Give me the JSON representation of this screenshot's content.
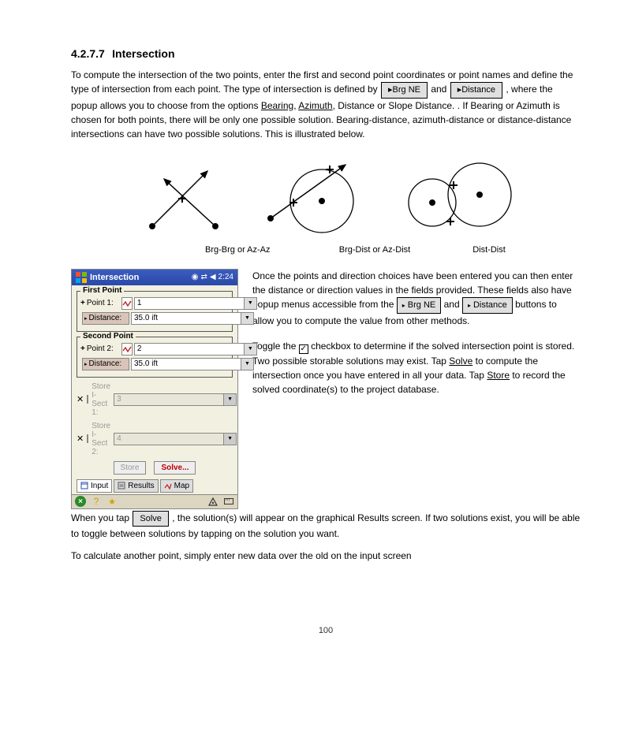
{
  "heading": {
    "num": "4.2.7.7",
    "title": "Intersection"
  },
  "para1": "To compute the intersection of the two points, enter the first and second point coordinates or point names and define the type of intersection from each point. The type of intersection is defined by ",
  "para1_mid": " and ",
  "para1_end": ", where the popup allows you to choose from the options ",
  "bearing": "Bearing",
  "azimuth": "Azimuth",
  "dist": "Distance",
  "para1_tail": " or ",
  "slope_dist": "Slope Distance",
  "para1_final": ". If Bearing or Azimuth is chosen for both points, there will be only one possible solution. Bearing-distance, azimuth-distance or distance-distance intersections can have two possible solutions. This is illustrated below.",
  "labels": {
    "l1": "Brg-Brg or Az-Az",
    "l2": "Brg-Dist or Az-Dist",
    "l3": "Dist-Dist"
  },
  "device": {
    "title": "Intersection",
    "time": "2:24",
    "fp": {
      "legend": "First Point",
      "point_lbl": "Point 1:",
      "point_val": "1",
      "dist_lbl": "Distance:",
      "dist_val": "35.0 ift"
    },
    "sp": {
      "legend": "Second Point",
      "point_lbl": "Point 2:",
      "point_val": "2",
      "dist_lbl": "Distance:",
      "dist_val": "35.0 ift"
    },
    "store1": {
      "lbl": "Store I-Sect 1:",
      "val": "3"
    },
    "store2": {
      "lbl": "Store I-Sect 2:",
      "val": "4"
    },
    "btn_store": "Store",
    "btn_solve": "Solve...",
    "tab_input": "Input",
    "tab_results": "Results",
    "tab_map": "Map"
  },
  "right": {
    "p1a": "Once the points and direction choices have been entered you can then enter the distance or direction values in the fields provided. These fields also have popup menus accessible from the ",
    "p1b": " and ",
    "p1c": " buttons to allow you to compute the value from other methods.",
    "p2a": "Toggle the ",
    "p2b": " checkbox to determine if the solved intersection point is stored. Two possible storable solutions may exist. ",
    "p2c": "Tap ",
    "solve": "Solve",
    "p2d": " to compute the intersection once you have entered in all your data. ",
    "p2e": "Tap ",
    "store": "Store",
    "p2f": " to record the solved coordinate(s) to the project database."
  },
  "below": {
    "p3a": "When you tap ",
    "p3b": ", the solution(s) will appear on the graphical Results screen. If two solutions exist, you will be able to toggle between solutions by tapping on the solution you want.",
    "p4": "To calculate another point, simply enter new data over the old on the input screen"
  },
  "pagenum": "100"
}
